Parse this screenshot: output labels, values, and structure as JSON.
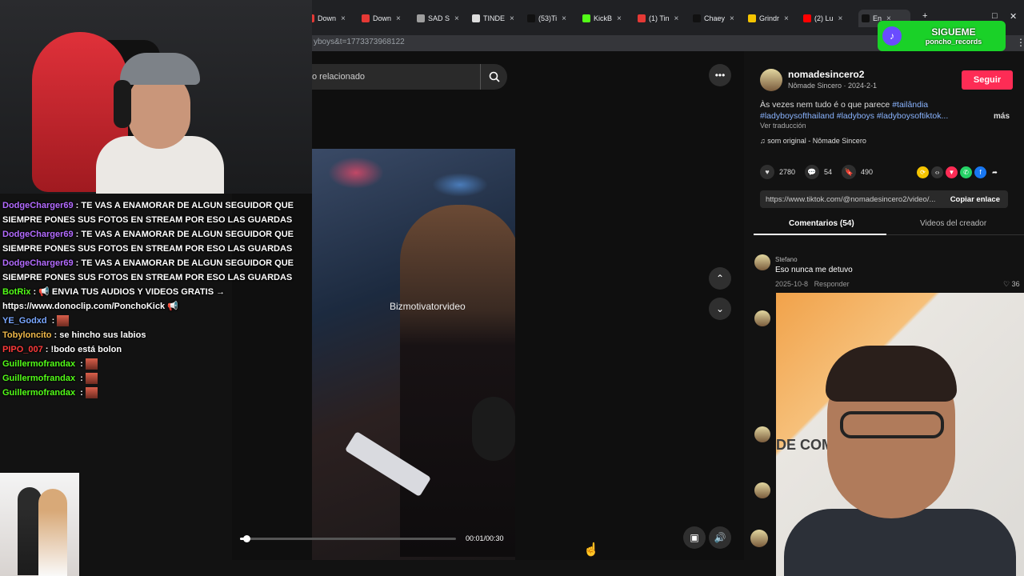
{
  "browser": {
    "tabs": [
      {
        "label": "Down",
        "color": "#e53935"
      },
      {
        "label": "Down",
        "color": "#e53935"
      },
      {
        "label": "SAD S",
        "color": "#9e9e9e"
      },
      {
        "label": "TINDE",
        "color": "#dddddd"
      },
      {
        "label": "(53)Ti",
        "color": "#111111"
      },
      {
        "label": "KickB",
        "color": "#53fc18"
      },
      {
        "label": "(1) Tin",
        "color": "#e53935"
      },
      {
        "label": "Chaey",
        "color": "#111111"
      },
      {
        "label": "Grindr",
        "color": "#f5c400"
      },
      {
        "label": "(2) Lu",
        "color": "#ff0000"
      },
      {
        "label": "En",
        "color": "#111111"
      }
    ],
    "url": "yboys&t=1773373968122"
  },
  "video": {
    "search_placeholder": "o relacionado",
    "watermark": "Bizmotivatorvideo",
    "time": "00:01/00:30",
    "progress": 0.03
  },
  "author": {
    "name": "nomadesincero2",
    "meta": "Nômade Sincero · 2024-2-1",
    "follow_label": "Seguir",
    "caption_text": "Às vezes nem tudo é o que parece ",
    "caption_tags": "#tailândia #ladyboysofthailand #ladyboys #ladyboysoftiktok...",
    "more_label": "más",
    "translate_label": "Ver traducción",
    "music": "som original - Nômade Sincero"
  },
  "stats": {
    "likes": "2780",
    "comments": "54",
    "saves": "490"
  },
  "share": {
    "link": "https://www.tiktok.com/@nomadesincero2/video/...",
    "copy_label": "Copiar enlace"
  },
  "comment_tabs": {
    "comments_label": "Comentarios (54)",
    "creator_label": "Videos del creador"
  },
  "comment": {
    "user": "Stefano",
    "text": "Eso nunca me detuvo",
    "date": "2025-10-8",
    "reply_label": "Responder",
    "likes": "36"
  },
  "chat": [
    {
      "user": "DodgeCharger69",
      "color": "#b36bff",
      "msg": ": TE VAS A ENAMORAR DE ALGUN SEGUIDOR QUE SIEMPRE PONES SUS FOTOS EN STREAM POR ESO LAS GUARDAS"
    },
    {
      "user": "DodgeCharger69",
      "color": "#b36bff",
      "msg": ": TE VAS A ENAMORAR DE ALGUN SEGUIDOR QUE SIEMPRE PONES SUS FOTOS EN STREAM POR ESO LAS GUARDAS"
    },
    {
      "user": "DodgeCharger69",
      "color": "#b36bff",
      "msg": ": TE VAS A ENAMORAR DE ALGUN SEGUIDOR QUE SIEMPRE PONES SUS FOTOS EN STREAM POR ESO LAS GUARDAS"
    },
    {
      "user": "BotRix",
      "color": "#53fc18",
      "msg": ": 📢 ENVIA TUS AUDIOS Y VIDEOS GRATIS → https://www.donoclip.com/PonchoKick 📢"
    },
    {
      "user": "YE_Godxd",
      "color": "#7aa7ff",
      "msg": " :",
      "emote": true
    },
    {
      "user": "Tobyloncito",
      "color": "#f0b94a",
      "msg": ": se hincho sus labios"
    },
    {
      "user": "PIPO_007",
      "color": "#ff3b3b",
      "msg": ": !bodo está bolon"
    },
    {
      "user": "Guillermofrandax",
      "color": "#53fc18",
      "msg": " :",
      "emote": true
    },
    {
      "user": "Guillermofrandax",
      "color": "#53fc18",
      "msg": " :",
      "emote": true
    },
    {
      "user": "Guillermofrandax",
      "color": "#53fc18",
      "msg": " :",
      "emote": true
    }
  ],
  "overlay": {
    "badge_title": "SIGUEME",
    "badge_sub": "poncho_records",
    "sign_text": "DE COM"
  }
}
